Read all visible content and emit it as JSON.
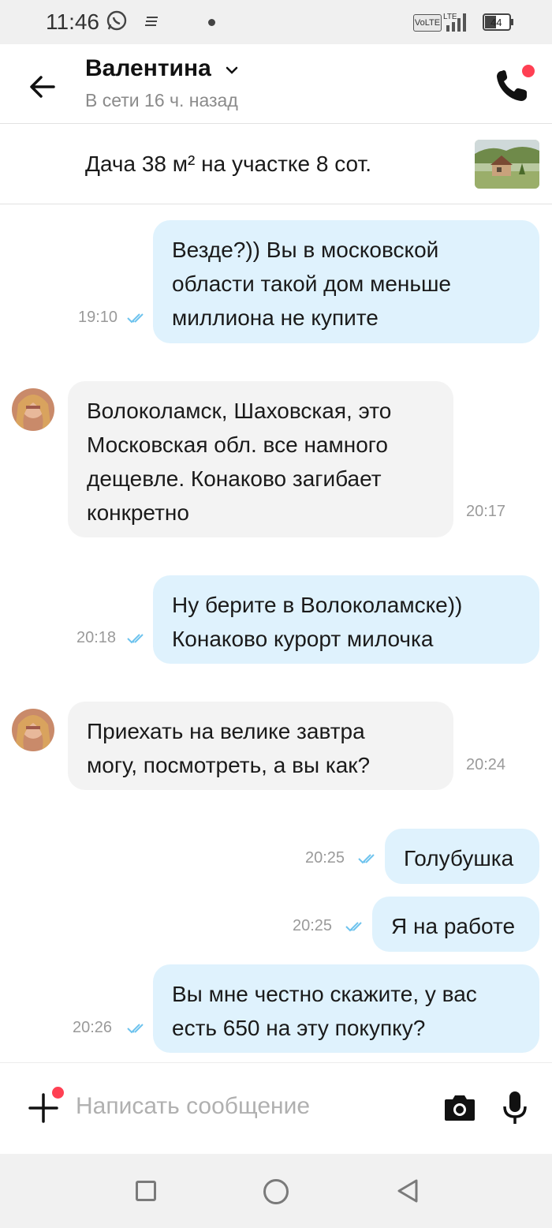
{
  "status_bar": {
    "time": "11:46",
    "volte": "VoLTE",
    "network": "LTE",
    "battery": "44",
    "icons": [
      "whatsapp-icon",
      "notes-icon",
      "dot-icon",
      "signal-icon",
      "battery-icon"
    ]
  },
  "header": {
    "name": "Валентина",
    "status": "В сети 16 ч. назад",
    "icons": [
      "back-arrow-icon",
      "chevron-down-icon",
      "phone-icon"
    ]
  },
  "ad": {
    "title": "Дача 38 м² на участке 8 сот."
  },
  "messages": [
    {
      "dir": "out",
      "text": "Везде?)) Вы в московской\nобласти такой дом меньше\nмиллиона не купите",
      "time": "19:10",
      "read": true
    },
    {
      "dir": "in",
      "text": "Волоколамск, Шаховская, это\nМосковская обл. все намного\nдещевле. Конаково загибает\nконкретно",
      "time": "20:17"
    },
    {
      "dir": "out",
      "text": "Ну берите в Волоколамске))\nКонаково курорт милочка",
      "time": "20:18",
      "read": true
    },
    {
      "dir": "in",
      "text": "Приехать на велике завтра\nмогу, посмотреть, а вы как?",
      "time": "20:24"
    },
    {
      "dir": "out",
      "text": "Голубушка",
      "time": "20:25",
      "read": true
    },
    {
      "dir": "out",
      "text": "Я на работе",
      "time": "20:25",
      "read": true
    },
    {
      "dir": "out",
      "text": "Вы мне честно скажите, у вас\nесть 650 на эту покупку?",
      "time": "20:26",
      "read": true
    }
  ],
  "input": {
    "placeholder": "Написать сообщение",
    "icons": [
      "plus-icon",
      "camera-icon",
      "microphone-icon"
    ]
  },
  "nav": {
    "icons": [
      "recents-square-icon",
      "home-circle-icon",
      "back-triangle-icon"
    ]
  },
  "colors": {
    "outgoing_bubble": "#dff2fd",
    "incoming_bubble": "#f3f3f3",
    "read_ticks": "#6ec3ee",
    "badge_red": "#ff4053"
  }
}
